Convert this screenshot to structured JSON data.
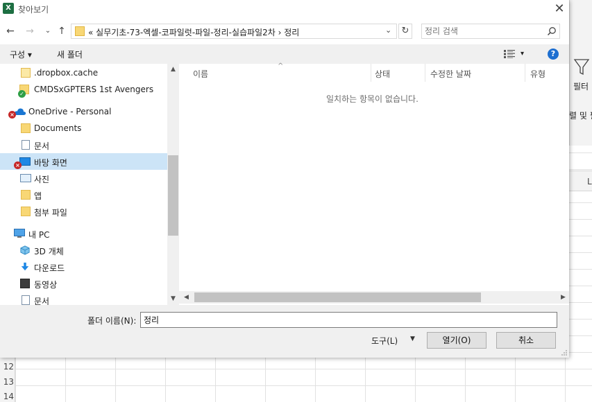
{
  "window": {
    "title": "찾아보기",
    "app_icon": "X"
  },
  "nav": {
    "back": "←",
    "forward": "→",
    "recent": "⌄",
    "up": "↑",
    "address": "«  실무기초-73-엑셀-코파일럿-파일-정리-실습파일2차  ›  정리",
    "address_dropdown": "⌄",
    "refresh": "↻",
    "search_placeholder": "정리 검색"
  },
  "toolbar": {
    "organize": "구성 ▾",
    "new_folder": "새 폴더",
    "view_dropdown": "▾",
    "help": "?"
  },
  "tree": [
    {
      "label": ".dropbox.cache",
      "icon": "folder-icon"
    },
    {
      "label": "CMDSxGPTERS 1st Avengers",
      "icon": "shared-folder-icon"
    },
    {
      "label": "OneDrive - Personal",
      "icon": "onedrive-icon"
    },
    {
      "label": "Documents",
      "icon": "folder-icon"
    },
    {
      "label": "문서",
      "icon": "document-icon"
    },
    {
      "label": "바탕 화면",
      "icon": "desktop-icon"
    },
    {
      "label": "사진",
      "icon": "pictures-icon"
    },
    {
      "label": "앱",
      "icon": "folder-icon"
    },
    {
      "label": "첨부 파일",
      "icon": "folder-icon"
    },
    {
      "label": "내 PC",
      "icon": "pc-icon"
    },
    {
      "label": "3D 개체",
      "icon": "3d-objects-icon"
    },
    {
      "label": "다운로드",
      "icon": "download-icon"
    },
    {
      "label": "동영상",
      "icon": "video-icon"
    },
    {
      "label": "문서",
      "icon": "document-icon"
    }
  ],
  "columns": {
    "name": "이름",
    "status": "상태",
    "modified": "수정한 날짜",
    "type": "유형",
    "sort_indicator": "^"
  },
  "empty_message": "일치하는 항목이 없습니다.",
  "bottom": {
    "folder_name_label": "폴더 이름(N):",
    "folder_name_value": "정리",
    "tools": "도구(L)",
    "tools_arrow": "▼",
    "open_button": "열기(O)",
    "cancel_button": "취소"
  },
  "excel_bg": {
    "filter_label": "필터",
    "filter_label2": "렬 및 필",
    "column_letter": "L",
    "rows": [
      "12",
      "13",
      "14"
    ]
  },
  "colors": {
    "selected_row": "#cce4f7",
    "help_blue": "#1e6fd0",
    "folder_yellow": "#f8d775",
    "excel_green": "#1d6f42",
    "error_red": "#c62828"
  }
}
